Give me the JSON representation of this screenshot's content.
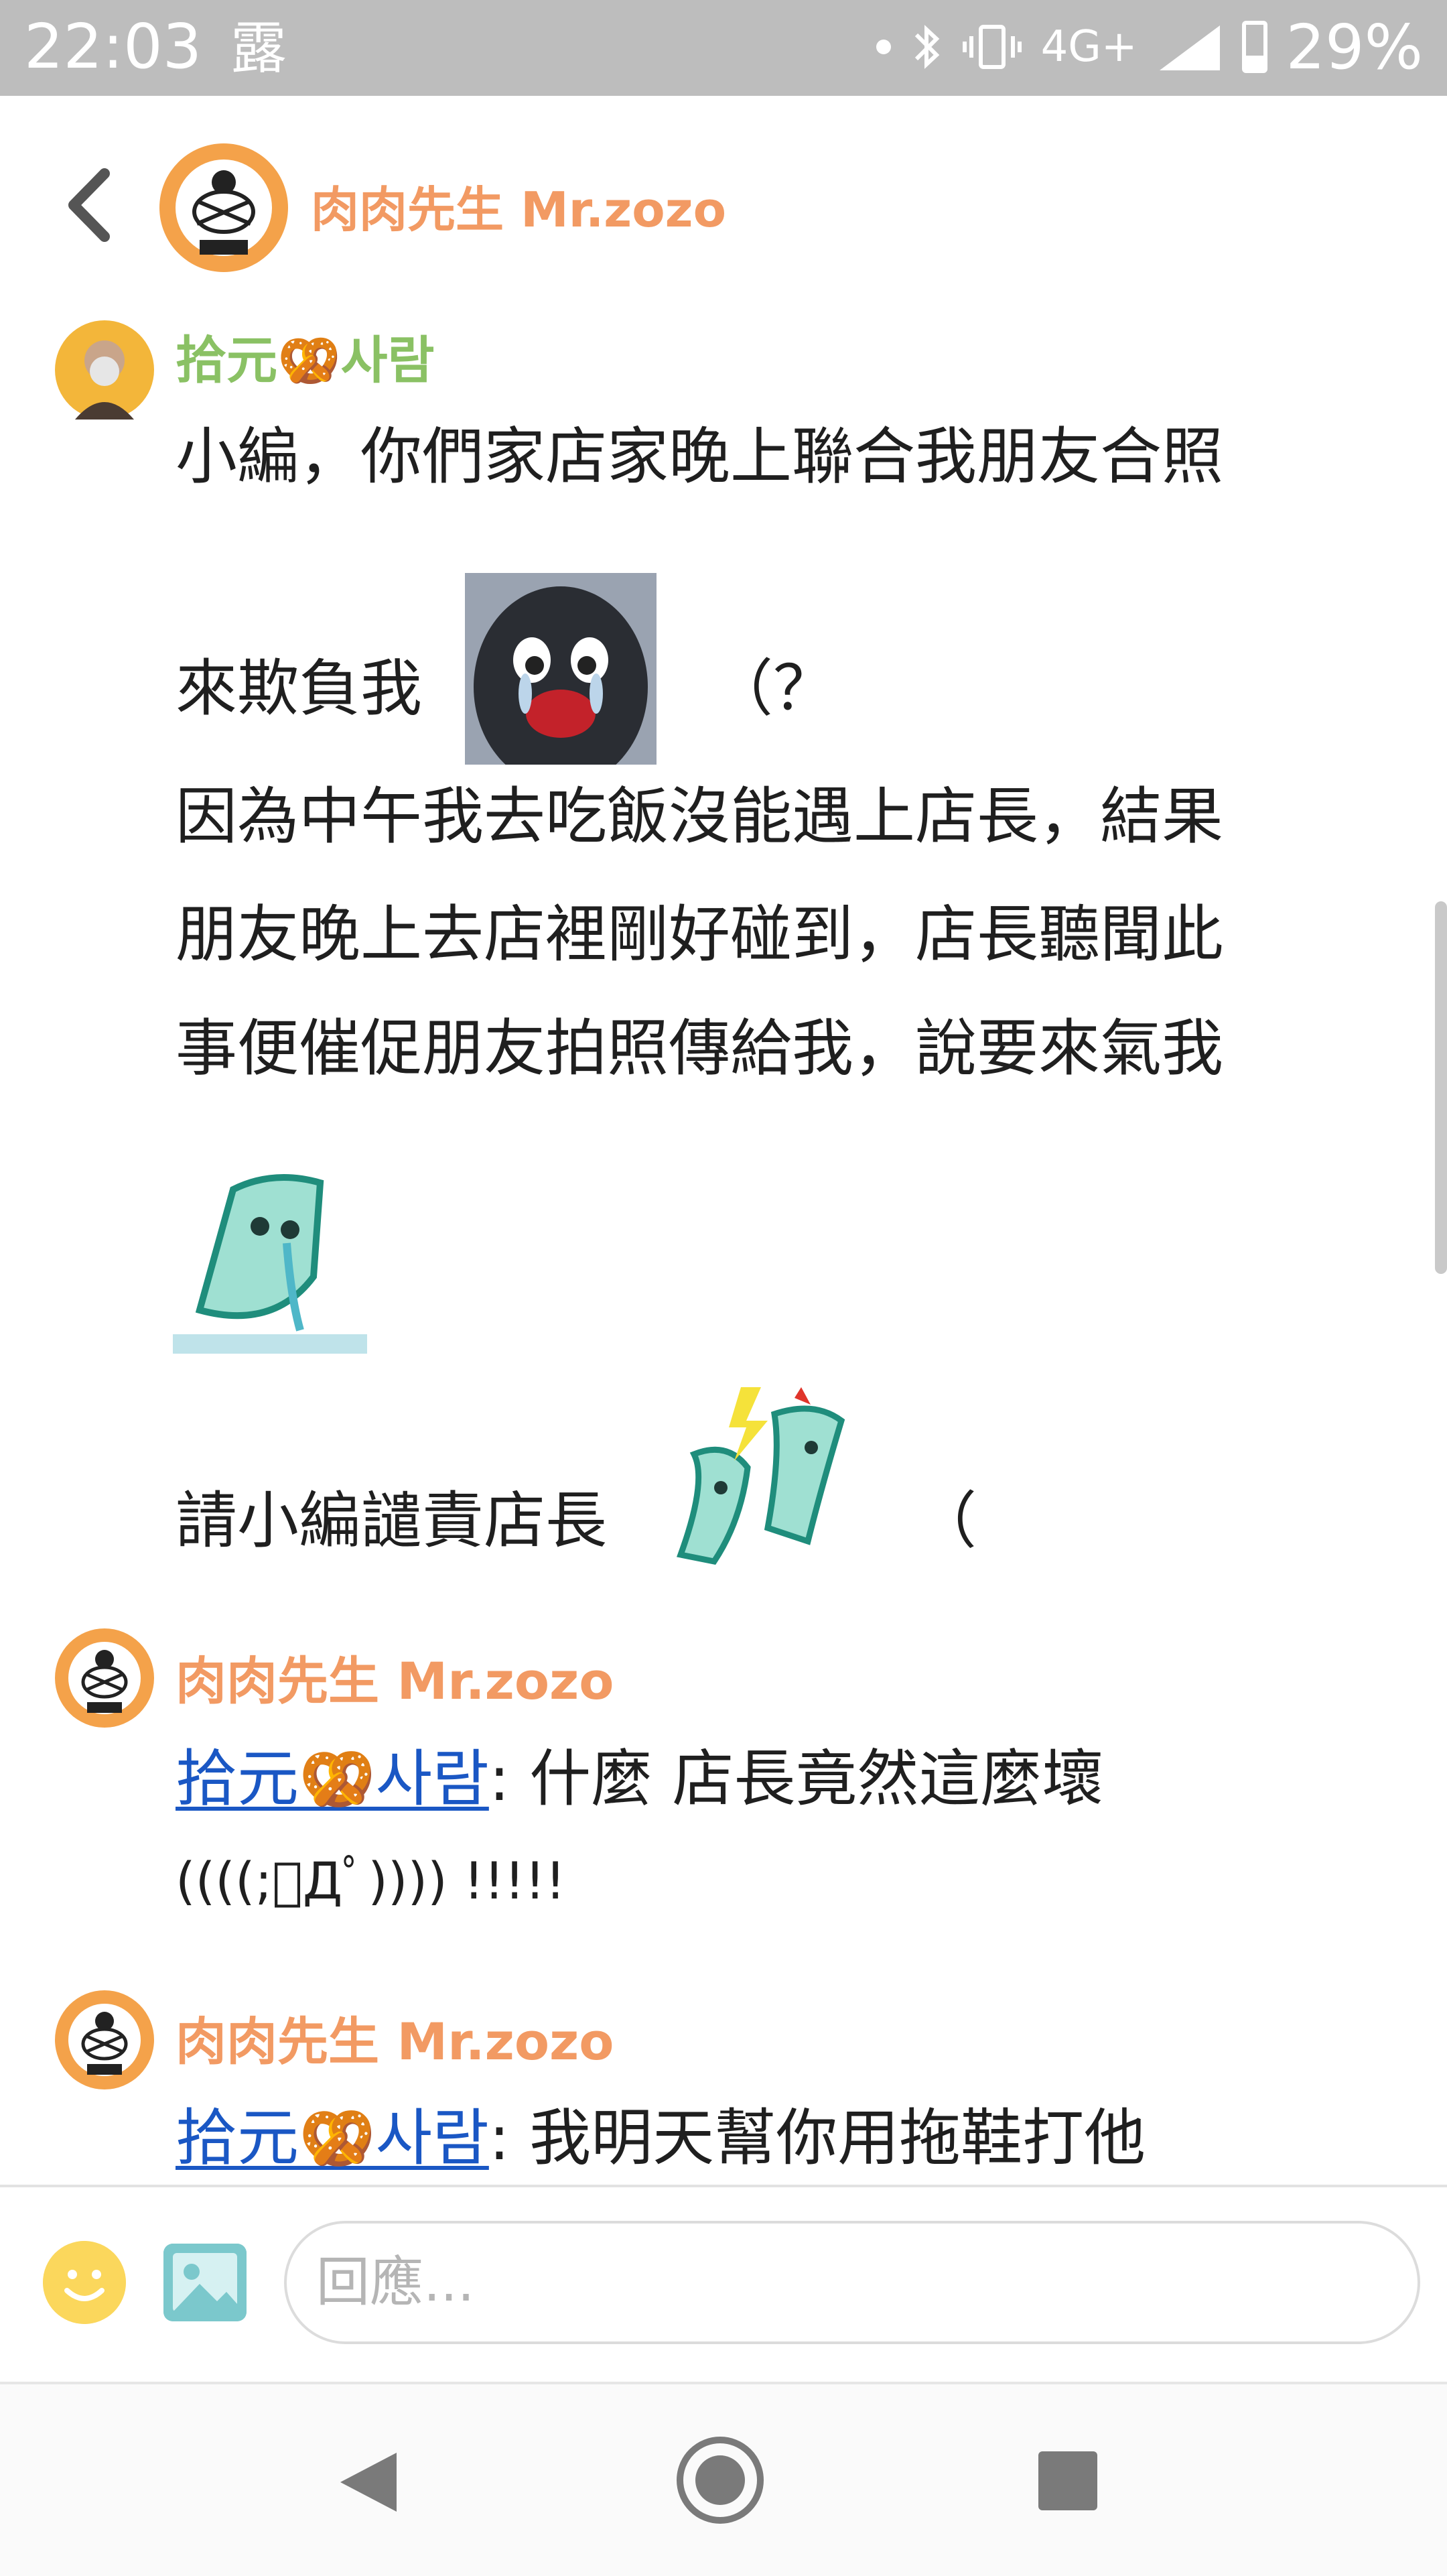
{
  "status_bar": {
    "time": "22:03",
    "notification": "露",
    "network": "4G+",
    "battery": "29%"
  },
  "header": {
    "title": "肉肉先生 Mr.zozo"
  },
  "messages": [
    {
      "sender": "拾元🥨사람",
      "lines": [
        "小編，你們家店家晚上聯合我朋友合照",
        "來欺負我",
        "（？",
        "因為中午我去吃飯沒能遇上店長，結果",
        "朋友晚上去店裡剛好碰到，店長聽聞此",
        "事便催促朋友拍照傳給我，說要來氣我",
        "請小編譴責店長",
        "（"
      ]
    },
    {
      "sender": "肉肉先生 Mr.zozo",
      "mention": "拾元🥨사람",
      "text": ": 什麼 店長竟然這麼壞",
      "text2": "((((;ﾟДﾟ)))) !!!!!"
    },
    {
      "sender": "肉肉先生 Mr.zozo",
      "mention": "拾元🥨사람",
      "text": ": 我明天幫你用拖鞋打他"
    }
  ],
  "input": {
    "placeholder": "回應..."
  },
  "colors": {
    "accent": "#f29a63",
    "sender_green": "#8ac164",
    "mention_blue": "#1a57c4"
  }
}
